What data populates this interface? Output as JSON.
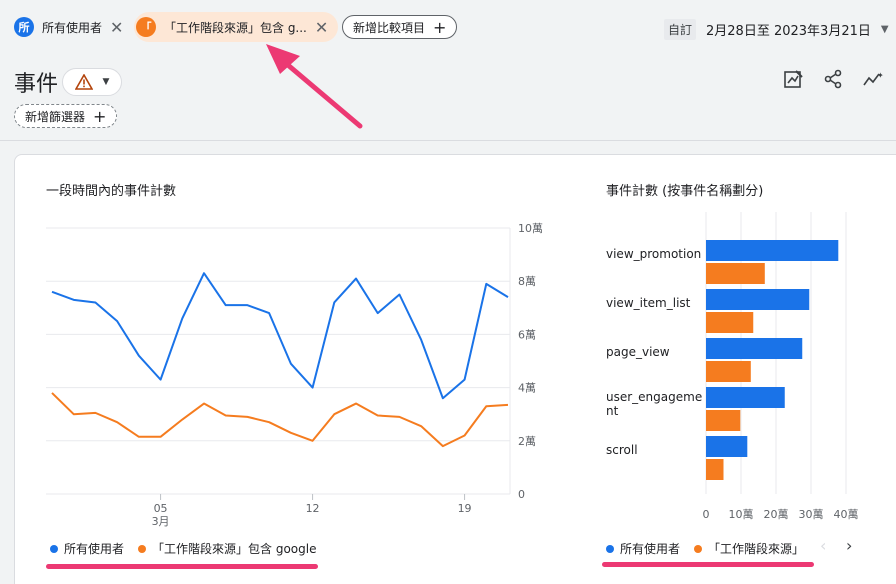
{
  "topbar": {
    "chip1_avatar": "所",
    "chip1_label": "所有使用者",
    "chip2_avatar": "「",
    "chip2_label": "「工作階段來源」包含 g...",
    "add_compare_label": "新增比較項目",
    "date_tag": "自訂",
    "date_range": "2月28日至 2023年3月21日"
  },
  "header": {
    "title": "事件",
    "add_filter_label": "新增篩選器"
  },
  "line_card": {
    "title": "一段時間內的事件計數",
    "legend": [
      "所有使用者",
      "「工作階段來源」包含 google"
    ]
  },
  "bar_card": {
    "title": "事件計數 (按事件名稱劃分)",
    "legend": [
      "所有使用者",
      "「工作階段來源」"
    ]
  },
  "colors": {
    "blue": "#1a73e8",
    "orange": "#f57c1f",
    "pink": "#ec3973"
  },
  "chart_data": [
    {
      "type": "line",
      "title": "一段時間內的事件計數",
      "x_ticks": [
        "05",
        "12",
        "19"
      ],
      "x_subtick": "3月",
      "x": [
        "2/28",
        "3/1",
        "3/2",
        "3/3",
        "3/4",
        "3/5",
        "3/6",
        "3/7",
        "3/8",
        "3/9",
        "3/10",
        "3/11",
        "3/12",
        "3/13",
        "3/14",
        "3/15",
        "3/16",
        "3/17",
        "3/18",
        "3/19",
        "3/20",
        "3/21"
      ],
      "y_tick_labels": [
        "0",
        "2萬",
        "4萬",
        "6萬",
        "8萬",
        "10萬"
      ],
      "ylim": [
        0,
        100000
      ],
      "series": [
        {
          "name": "所有使用者",
          "color": "#1a73e8",
          "values": [
            76000,
            73000,
            72000,
            65000,
            52000,
            43000,
            66000,
            83000,
            71000,
            71000,
            68000,
            49000,
            40000,
            72000,
            81000,
            68000,
            75000,
            58000,
            36000,
            43000,
            79000,
            74000
          ]
        },
        {
          "name": "「工作階段來源」包含 google",
          "color": "#f57c1f",
          "values": [
            38000,
            30000,
            30500,
            27000,
            21500,
            21500,
            28000,
            34000,
            29500,
            29000,
            27000,
            23000,
            20000,
            30000,
            34000,
            29500,
            29000,
            25500,
            18000,
            22000,
            33000,
            33500
          ]
        }
      ]
    },
    {
      "type": "bar",
      "title": "事件計數 (按事件名稱劃分)",
      "categories": [
        "view_promotion",
        "view_item_list",
        "page_view",
        "user_engagement",
        "scroll"
      ],
      "x_tick_labels": [
        "0",
        "10萬",
        "20萬",
        "30萬",
        "40萬"
      ],
      "xlim": [
        0,
        400000
      ],
      "series": [
        {
          "name": "所有使用者",
          "color": "#1a73e8",
          "values": [
            378000,
            295000,
            275000,
            225000,
            118000
          ]
        },
        {
          "name": "「工作階段來源」",
          "color": "#f57c1f",
          "values": [
            168000,
            135000,
            128000,
            98000,
            50000
          ]
        }
      ]
    }
  ]
}
